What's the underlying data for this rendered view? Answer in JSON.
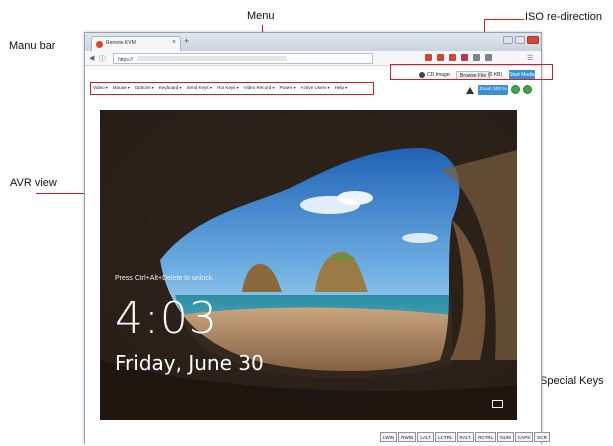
{
  "annotations": {
    "menu": "Menu",
    "manu_bar": "Manu bar",
    "iso": "ISO re-direction",
    "avr_view": "AVR view",
    "special_keys": "Special Keys"
  },
  "browser": {
    "tab_title": "Remote KVM",
    "tab_close": "×",
    "new_tab": "+",
    "url": "https://",
    "nav": [
      "back-icon",
      "forward-icon",
      "refresh-icon"
    ]
  },
  "iso": {
    "label": "CD Image:",
    "browse_label": "Browse File",
    "size": "(0 KB)",
    "start_label": "Start Media"
  },
  "menu_items": [
    "Video",
    "Mouse",
    "Options",
    "Keyboard",
    "Send Keys",
    "Hot Keys",
    "Video Record",
    "Power",
    "Active Users",
    "Help"
  ],
  "toolbar_right": {
    "zoom_label": "Zoom 100 %",
    "icons": [
      "warning-icon",
      "refresh-green-icon",
      "power-green-icon"
    ]
  },
  "lock_screen": {
    "hint": "Press Ctrl+Alt+Delete to unlock.",
    "time": "4:03",
    "date": "Friday, June 30"
  },
  "special_keys": [
    "LWIN",
    "RWIN",
    "LALT",
    "LCTRL",
    "RALT",
    "RCTRL",
    "NUM",
    "CAPS",
    "SCR"
  ],
  "colors": {
    "accent": "#3a8fd6",
    "callout_line": "#d21f1f",
    "green_button": "#3ca64a"
  }
}
